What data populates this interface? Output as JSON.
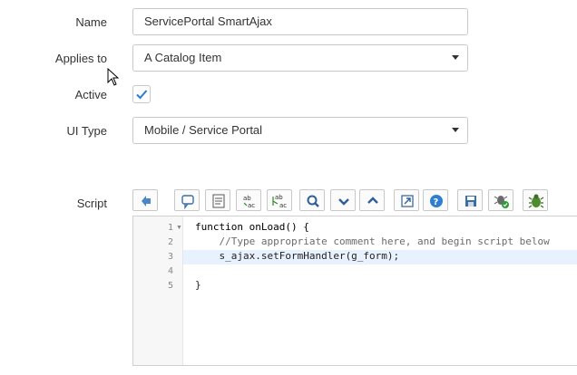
{
  "form": {
    "name": {
      "label": "Name",
      "value": "ServicePortal SmartAjax"
    },
    "applies_to": {
      "label": "Applies to",
      "value": "A Catalog Item"
    },
    "active": {
      "label": "Active",
      "checked": true
    },
    "ui_type": {
      "label": "UI Type",
      "value": "Mobile / Service Portal"
    },
    "script": {
      "label": "Script"
    }
  },
  "toolbar": {
    "buttons": [
      {
        "name": "format-code-icon"
      },
      {
        "name": "comment-icon"
      },
      {
        "name": "document-list-icon"
      },
      {
        "name": "replace-icon"
      },
      {
        "name": "replace-all-icon"
      },
      {
        "name": "search-icon"
      },
      {
        "name": "chevron-down-icon"
      },
      {
        "name": "chevron-up-icon"
      },
      {
        "name": "fullscreen-icon"
      },
      {
        "name": "help-icon"
      },
      {
        "name": "save-icon"
      },
      {
        "name": "script-check-icon"
      },
      {
        "name": "debug-icon"
      }
    ]
  },
  "editor": {
    "line_numbers": [
      "1",
      "2",
      "3",
      "4",
      "5"
    ],
    "lines": [
      "function onLoad() {",
      "    //Type appropriate comment here, and begin script below",
      "    s_ajax.setFormHandler(g_form);",
      "",
      "}"
    ]
  },
  "colors": {
    "accent": "#1f6fbf",
    "check": "#2b7bd3"
  }
}
